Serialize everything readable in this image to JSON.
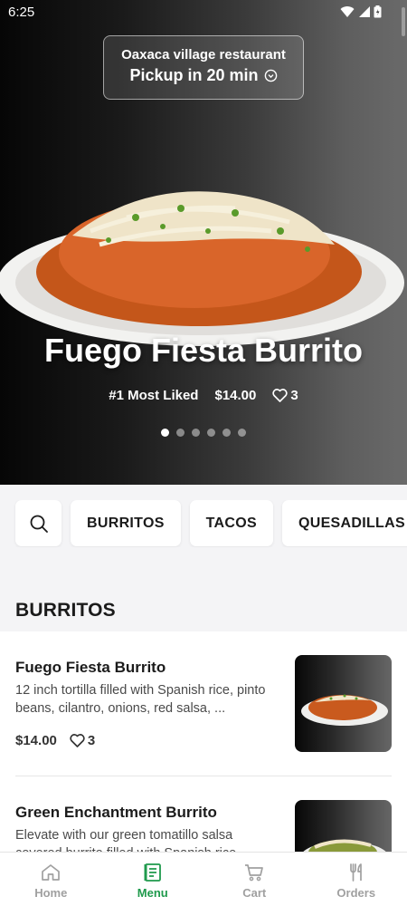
{
  "status_bar": {
    "time": "6:25"
  },
  "hero": {
    "restaurant": "Oaxaca village restaurant",
    "pickup": "Pickup in 20 min",
    "title": "Fuego Fiesta Burrito",
    "rank": "#1 Most Liked",
    "price": "$14.00",
    "likes": "3",
    "carousel_pages": 6,
    "carousel_active": 1
  },
  "categories": [
    "BURRITOS",
    "TACOS",
    "QUESADILLAS"
  ],
  "section_title": "BURRITOS",
  "items": [
    {
      "name": "Fuego Fiesta Burrito",
      "description": "12 inch tortilla filled with Spanish rice, pinto beans, cilantro, onions, red salsa, ...",
      "price": "$14.00",
      "likes": "3"
    },
    {
      "name": "Green Enchantment Burrito",
      "description": "Elevate with our green tomatillo salsa covered burrito filled with Spanish rice",
      "price": "",
      "likes": ""
    }
  ],
  "nav": {
    "home": "Home",
    "menu": "Menu",
    "cart": "Cart",
    "orders": "Orders"
  },
  "colors": {
    "accent": "#1f9a4c",
    "inactive": "#a0a0a0"
  }
}
